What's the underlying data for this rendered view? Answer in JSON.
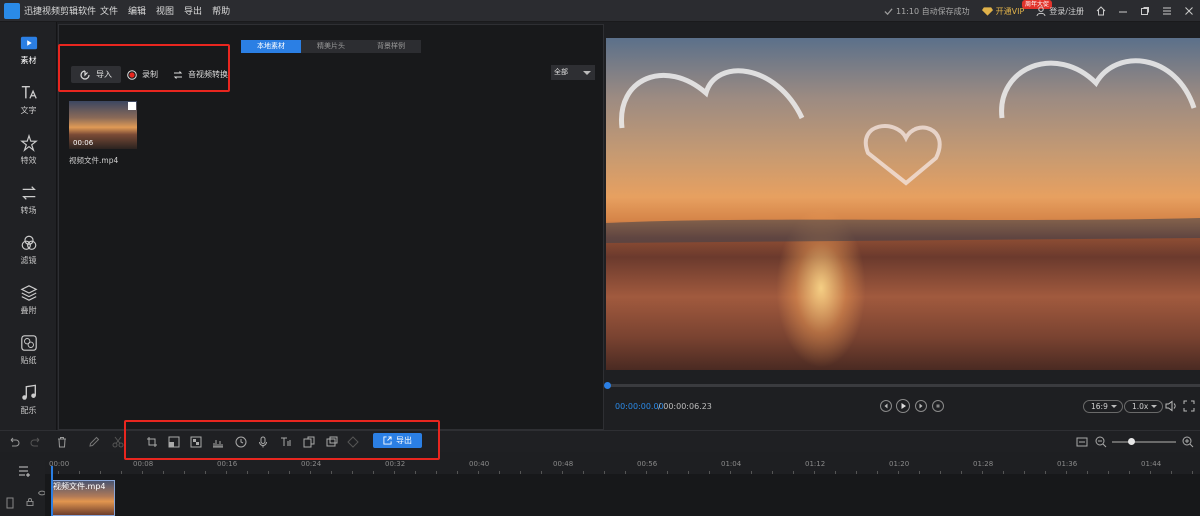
{
  "titlebar": {
    "app_title": "迅捷视频剪辑软件",
    "menu": [
      "文件",
      "编辑",
      "视图",
      "导出",
      "帮助"
    ],
    "autosave": "11:10 自动保存成功",
    "vip": "开通VIP",
    "vip_badge": "周年大促",
    "login": "登录/注册"
  },
  "sidebar": {
    "items": [
      {
        "label": "素材",
        "icon": "media-icon",
        "active": true
      },
      {
        "label": "文字",
        "icon": "text-icon"
      },
      {
        "label": "特效",
        "icon": "effects-icon"
      },
      {
        "label": "转场",
        "icon": "transition-icon"
      },
      {
        "label": "滤镜",
        "icon": "filter-icon"
      },
      {
        "label": "叠附",
        "icon": "overlay-icon"
      },
      {
        "label": "贴纸",
        "icon": "sticker-icon"
      },
      {
        "label": "配乐",
        "icon": "music-icon"
      }
    ]
  },
  "media": {
    "tabs": [
      "本地素材",
      "精美片头",
      "背景样例"
    ],
    "import_label": "导入",
    "record_label": "录制",
    "convert_label": "音视频转换",
    "filter_value": "全部",
    "file": {
      "duration": "00:06",
      "name": "视频文件.mp4"
    }
  },
  "player": {
    "current_time": "00:00:00.00",
    "total_time": "/ 00:00:06.23",
    "ratio": "16:9",
    "speed": "1.0x"
  },
  "toolbar": {
    "export_label": "导出"
  },
  "timeline": {
    "ticks": [
      "00:00",
      "00:08",
      "00:16",
      "00:24",
      "00:32",
      "00:40",
      "00:48",
      "00:56",
      "01:04",
      "01:12",
      "01:20",
      "01:28",
      "01:36",
      "01:44"
    ],
    "clip_name": "视频文件.mp4"
  },
  "colors": {
    "accent": "#2b7fe4",
    "highlight_box": "#e8261f"
  }
}
